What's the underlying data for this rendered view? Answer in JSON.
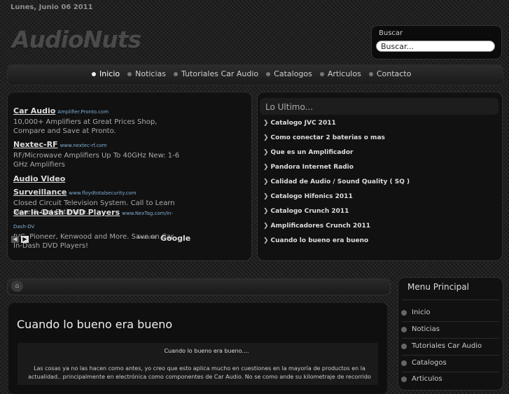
{
  "header": {
    "date": "Lunes, Junio 06 2011",
    "logo": "AudioNuts",
    "search_label": "Buscar",
    "search_value": "Buscar..."
  },
  "nav": [
    "Inicio",
    "Noticias",
    "Tutoriales Car Audio",
    "Catalogos",
    "Articulos",
    "Contacto"
  ],
  "ads": [
    {
      "title": "Car Audio",
      "url": "Amplifier.Pronto.com",
      "desc": "10,000+ Amplifiers at Great Prices Shop, Compare and Save at Pronto."
    },
    {
      "title": "Nextec-RF",
      "url": "www.nextec-rf.com",
      "desc": "RF/Microwave Amplifiers Up To 40GHz New: 1-6 GHz Amplifiers"
    },
    {
      "title": "Audio Video Surveillance",
      "url": "www.floydtotalsecurity.com",
      "desc": "Closed Circuit Television System. Call to Learn More & Get Estimate."
    },
    {
      "title": "Car In-Dash DVD Players",
      "url": "www.NexTag.com/In-Dash-DV",
      "desc": "JVC, Pioneer, Kenwood and More. Save on Car In-Dash DVD Players!"
    }
  ],
  "ads_footer": {
    "by": "Anuncios",
    "brand": "Google"
  },
  "latest": {
    "title": "Lo Ultimo...",
    "items": [
      "Catalogo JVC 2011",
      "Como conectar 2 baterias o mas",
      "Que es un Amplificador",
      "Pandora Internet Radio",
      "Calidad de Audio / Sound Quality ( SQ )",
      "Catalogo Hifonics 2011",
      "Catalogo Crunch 2011",
      "Amplificadores Crunch 2011",
      "Cuando lo bueno era bueno"
    ]
  },
  "article": {
    "title": "Cuando lo bueno era bueno",
    "subtitle": "Cuando lo bueno era bueno....",
    "text": "Las cosas ya no las hacen como antes, yo creo que esto aplica mucho en cuestiones en la mayoría de productos en la actualidad.. principalmente en electrónica como componentes de Car Audio. No se como ande su kilometraje de recorrido"
  },
  "menu": {
    "title": "Menu Principal",
    "items": [
      "Inicio",
      "Noticias",
      "Tutoriales Car Audio",
      "Catalogos",
      "Articulos"
    ]
  },
  "colors": {
    "background": "#1c1c1c",
    "panel": "#111111",
    "link": "#7eaed6"
  }
}
